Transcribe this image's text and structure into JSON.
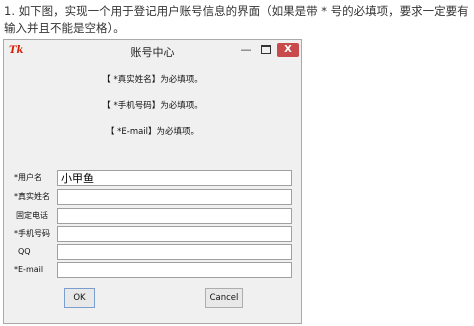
{
  "question_text": "1. 如下图，实现一个用于登记用户账号信息的界面（如果是带 * 号的必填项，要求一定要有输入并且不能是空格）。",
  "window": {
    "icon_text": "Tk",
    "title": "账号中心",
    "controls": {
      "minimize": "—",
      "close": "X"
    }
  },
  "notes": [
    "【 *真实姓名】为必填项。",
    "【 *手机号码】为必填项。",
    "【 *E-mail】为必填项。"
  ],
  "form": {
    "fields": [
      {
        "label": "*用户名",
        "value": "小甲鱼"
      },
      {
        "label": "*真实姓名",
        "value": ""
      },
      {
        "label": "固定电话",
        "value": ""
      },
      {
        "label": "*手机号码",
        "value": ""
      },
      {
        "label": "QQ",
        "value": ""
      },
      {
        "label": "*E-mail",
        "value": ""
      }
    ]
  },
  "buttons": {
    "ok": "OK",
    "cancel": "Cancel"
  },
  "colors": {
    "window_bg": "#f0f0f0",
    "close_bg": "#c94a4a",
    "icon": "#d81e06"
  }
}
